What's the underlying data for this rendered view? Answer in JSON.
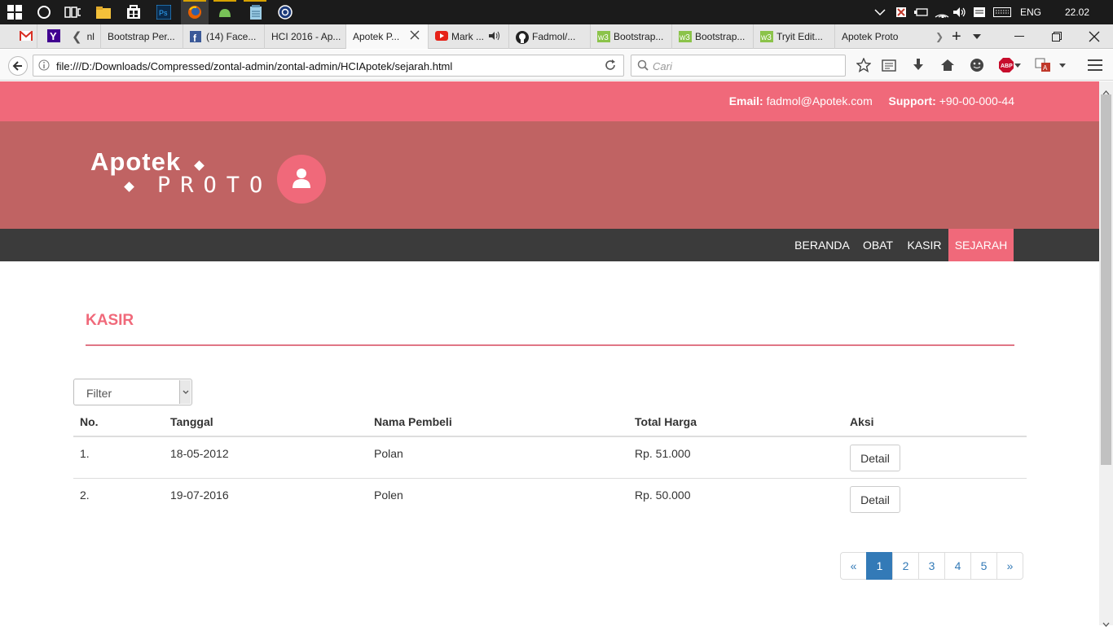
{
  "os": {
    "tray": {
      "language": "ENG",
      "time": "22.02"
    }
  },
  "browser": {
    "tabs": [
      {
        "label": "nl"
      },
      {
        "label": "Bootstrap Per..."
      },
      {
        "label": "(14) Face..."
      },
      {
        "label": "HCI 2016 - Ap..."
      },
      {
        "label": "Apotek P..."
      },
      {
        "label": "Mark ..."
      },
      {
        "label": "Fadmol/..."
      },
      {
        "label": "Bootstrap..."
      },
      {
        "label": "Bootstrap..."
      },
      {
        "label": "Tryit Edit..."
      },
      {
        "label": "Apotek Proto"
      }
    ],
    "url": "file:///D:/Downloads/Compressed/zontal-admin/zontal-admin/HCIApotek/sejarah.html",
    "search_placeholder": "Cari",
    "abp_label": "ABP"
  },
  "site": {
    "contact": {
      "email_label": "Email:",
      "email_value": "fadmol@Apotek.com",
      "support_label": "Support:",
      "support_value": "+90-00-000-44"
    },
    "logo": {
      "word": "Apotek",
      "sub": "PROTO"
    },
    "menu": [
      {
        "label": "BERANDA"
      },
      {
        "label": "OBAT"
      },
      {
        "label": "KASIR"
      },
      {
        "label": "SEJARAH",
        "active": true
      }
    ],
    "colors": {
      "accent": "#f0697a",
      "header": "#c06363",
      "menubar": "#3b3b3b",
      "link": "#337ab7"
    }
  },
  "main": {
    "section_title": "KASIR",
    "filter": {
      "label": "Filter"
    },
    "table": {
      "headers": [
        "No.",
        "Tanggal",
        "Nama Pembeli",
        "Total Harga",
        "Aksi"
      ],
      "rows": [
        {
          "no": "1.",
          "tanggal": "18-05-2012",
          "nama": "Polan",
          "total": "Rp. 51.000",
          "aksi": "Detail"
        },
        {
          "no": "2.",
          "tanggal": "19-07-2016",
          "nama": "Polen",
          "total": "Rp. 50.000",
          "aksi": "Detail"
        }
      ]
    },
    "pagination": {
      "prev": "«",
      "pages": [
        "1",
        "2",
        "3",
        "4",
        "5"
      ],
      "next": "»",
      "current": "1"
    }
  }
}
